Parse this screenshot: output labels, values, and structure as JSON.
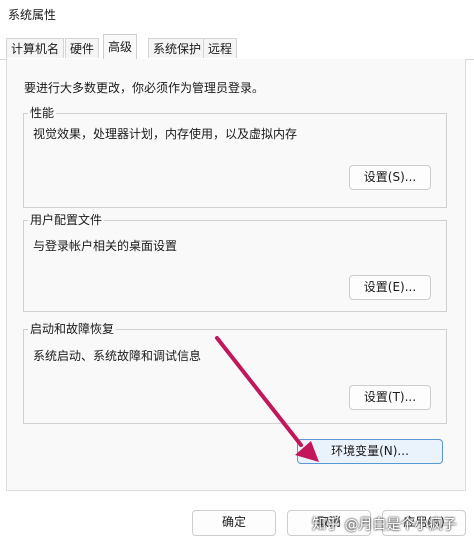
{
  "window": {
    "title": "系统属性"
  },
  "tabs": [
    {
      "label": "计算机名"
    },
    {
      "label": "硬件"
    },
    {
      "label": "高级"
    },
    {
      "label": "系统保护"
    },
    {
      "label": "远程"
    }
  ],
  "active_tab": "高级",
  "admin_note": "要进行大多数更改，你必须作为管理员登录。",
  "performance": {
    "label": "性能",
    "description": "视觉效果，处理器计划，内存使用，以及虚拟内存",
    "button": "设置(S)..."
  },
  "user_profiles": {
    "label": "用户配置文件",
    "description": "与登录帐户相关的桌面设置",
    "button": "设置(E)..."
  },
  "startup_recovery": {
    "label": "启动和故障恢复",
    "description": "系统启动、系统故障和调试信息",
    "button": "设置(T)..."
  },
  "env_button": "环境变量(N)...",
  "footer": {
    "ok": "确定",
    "cancel": "取消",
    "apply": "应用(A)"
  },
  "watermark": "知乎 @月白是个小疯子",
  "colors": {
    "arrow": "#c2185b",
    "accent": "#5b96d6"
  }
}
